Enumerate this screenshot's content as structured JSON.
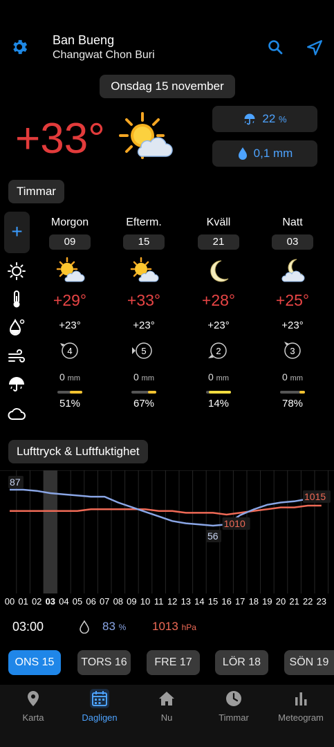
{
  "header": {
    "location": "Ban Bueng",
    "region": "Changwat Chon Buri"
  },
  "date_label": "Onsdag 15 november",
  "current": {
    "temperature": "+33°",
    "rain_probability": "22",
    "rain_probability_unit": "%",
    "precipitation": "0,1 mm"
  },
  "sections": {
    "hours_title": "Timmar",
    "pressure_title": "Lufttryck & Luftfuktighet"
  },
  "periods": [
    {
      "name": "Morgon",
      "hour": "09",
      "icon": "sun-cloud-icon",
      "temp": "+29°",
      "feels": "+23°",
      "wind": "4",
      "precip": "0",
      "precip_unit": "mm",
      "cloud": "51%"
    },
    {
      "name": "Efterm.",
      "hour": "15",
      "icon": "sun-cloud-icon",
      "temp": "+33°",
      "feels": "+23°",
      "wind": "5",
      "precip": "0",
      "precip_unit": "mm",
      "cloud": "67%"
    },
    {
      "name": "Kväll",
      "hour": "21",
      "icon": "moon-icon",
      "temp": "+28°",
      "feels": "+23°",
      "wind": "2",
      "precip": "0",
      "precip_unit": "mm",
      "cloud": "14%"
    },
    {
      "name": "Natt",
      "hour": "03",
      "icon": "moon-cloud-icon",
      "temp": "+25°",
      "feels": "+23°",
      "wind": "3",
      "precip": "0",
      "precip_unit": "mm",
      "cloud": "78%"
    }
  ],
  "chart_data": {
    "type": "line",
    "x": [
      "00",
      "01",
      "02",
      "03",
      "04",
      "05",
      "06",
      "07",
      "08",
      "09",
      "10",
      "11",
      "12",
      "13",
      "14",
      "15",
      "16",
      "17",
      "18",
      "19",
      "20",
      "21",
      "22",
      "23"
    ],
    "series": [
      {
        "name": "humidity",
        "unit": "%",
        "values": [
          87,
          87,
          86,
          84,
          83,
          82,
          81,
          81,
          76,
          72,
          68,
          64,
          60,
          58,
          57,
          56,
          57,
          65,
          70,
          74,
          76,
          77,
          79,
          81
        ]
      },
      {
        "name": "pressure",
        "unit": "hPa",
        "values": [
          1012,
          1012,
          1012,
          1012,
          1012,
          1012,
          1013,
          1013,
          1013,
          1013,
          1013,
          1012,
          1012,
          1011,
          1011,
          1011,
          1010,
          1011,
          1012,
          1013,
          1014,
          1014,
          1015,
          1015
        ]
      }
    ],
    "labels": {
      "humidity_max": "87",
      "humidity_min": "56",
      "pressure_min": "1010",
      "pressure_max": "1015"
    },
    "highlight_hour": "03"
  },
  "selection": {
    "time": "03:00",
    "humidity": "83",
    "humidity_unit": "%",
    "pressure": "1013",
    "pressure_unit": "hPa"
  },
  "days": [
    {
      "label": "ONS",
      "num": "15",
      "active": true
    },
    {
      "label": "TORS",
      "num": "16",
      "active": false
    },
    {
      "label": "FRE",
      "num": "17",
      "active": false
    },
    {
      "label": "LÖR",
      "num": "18",
      "active": false
    },
    {
      "label": "SÖN",
      "num": "19",
      "active": false
    }
  ],
  "tabs": [
    {
      "label": "Karta",
      "icon": "map-pin-icon"
    },
    {
      "label": "Dagligen",
      "icon": "calendar-icon",
      "active": true
    },
    {
      "label": "Nu",
      "icon": "home-icon"
    },
    {
      "label": "Timmar",
      "icon": "clock-icon"
    },
    {
      "label": "Meteogram",
      "icon": "bar-chart-icon"
    }
  ],
  "colors": {
    "accent": "#1f86e8",
    "temp": "#e23b3b",
    "humidity_line": "#8aa6e6",
    "pressure_line": "#ef6a56"
  }
}
